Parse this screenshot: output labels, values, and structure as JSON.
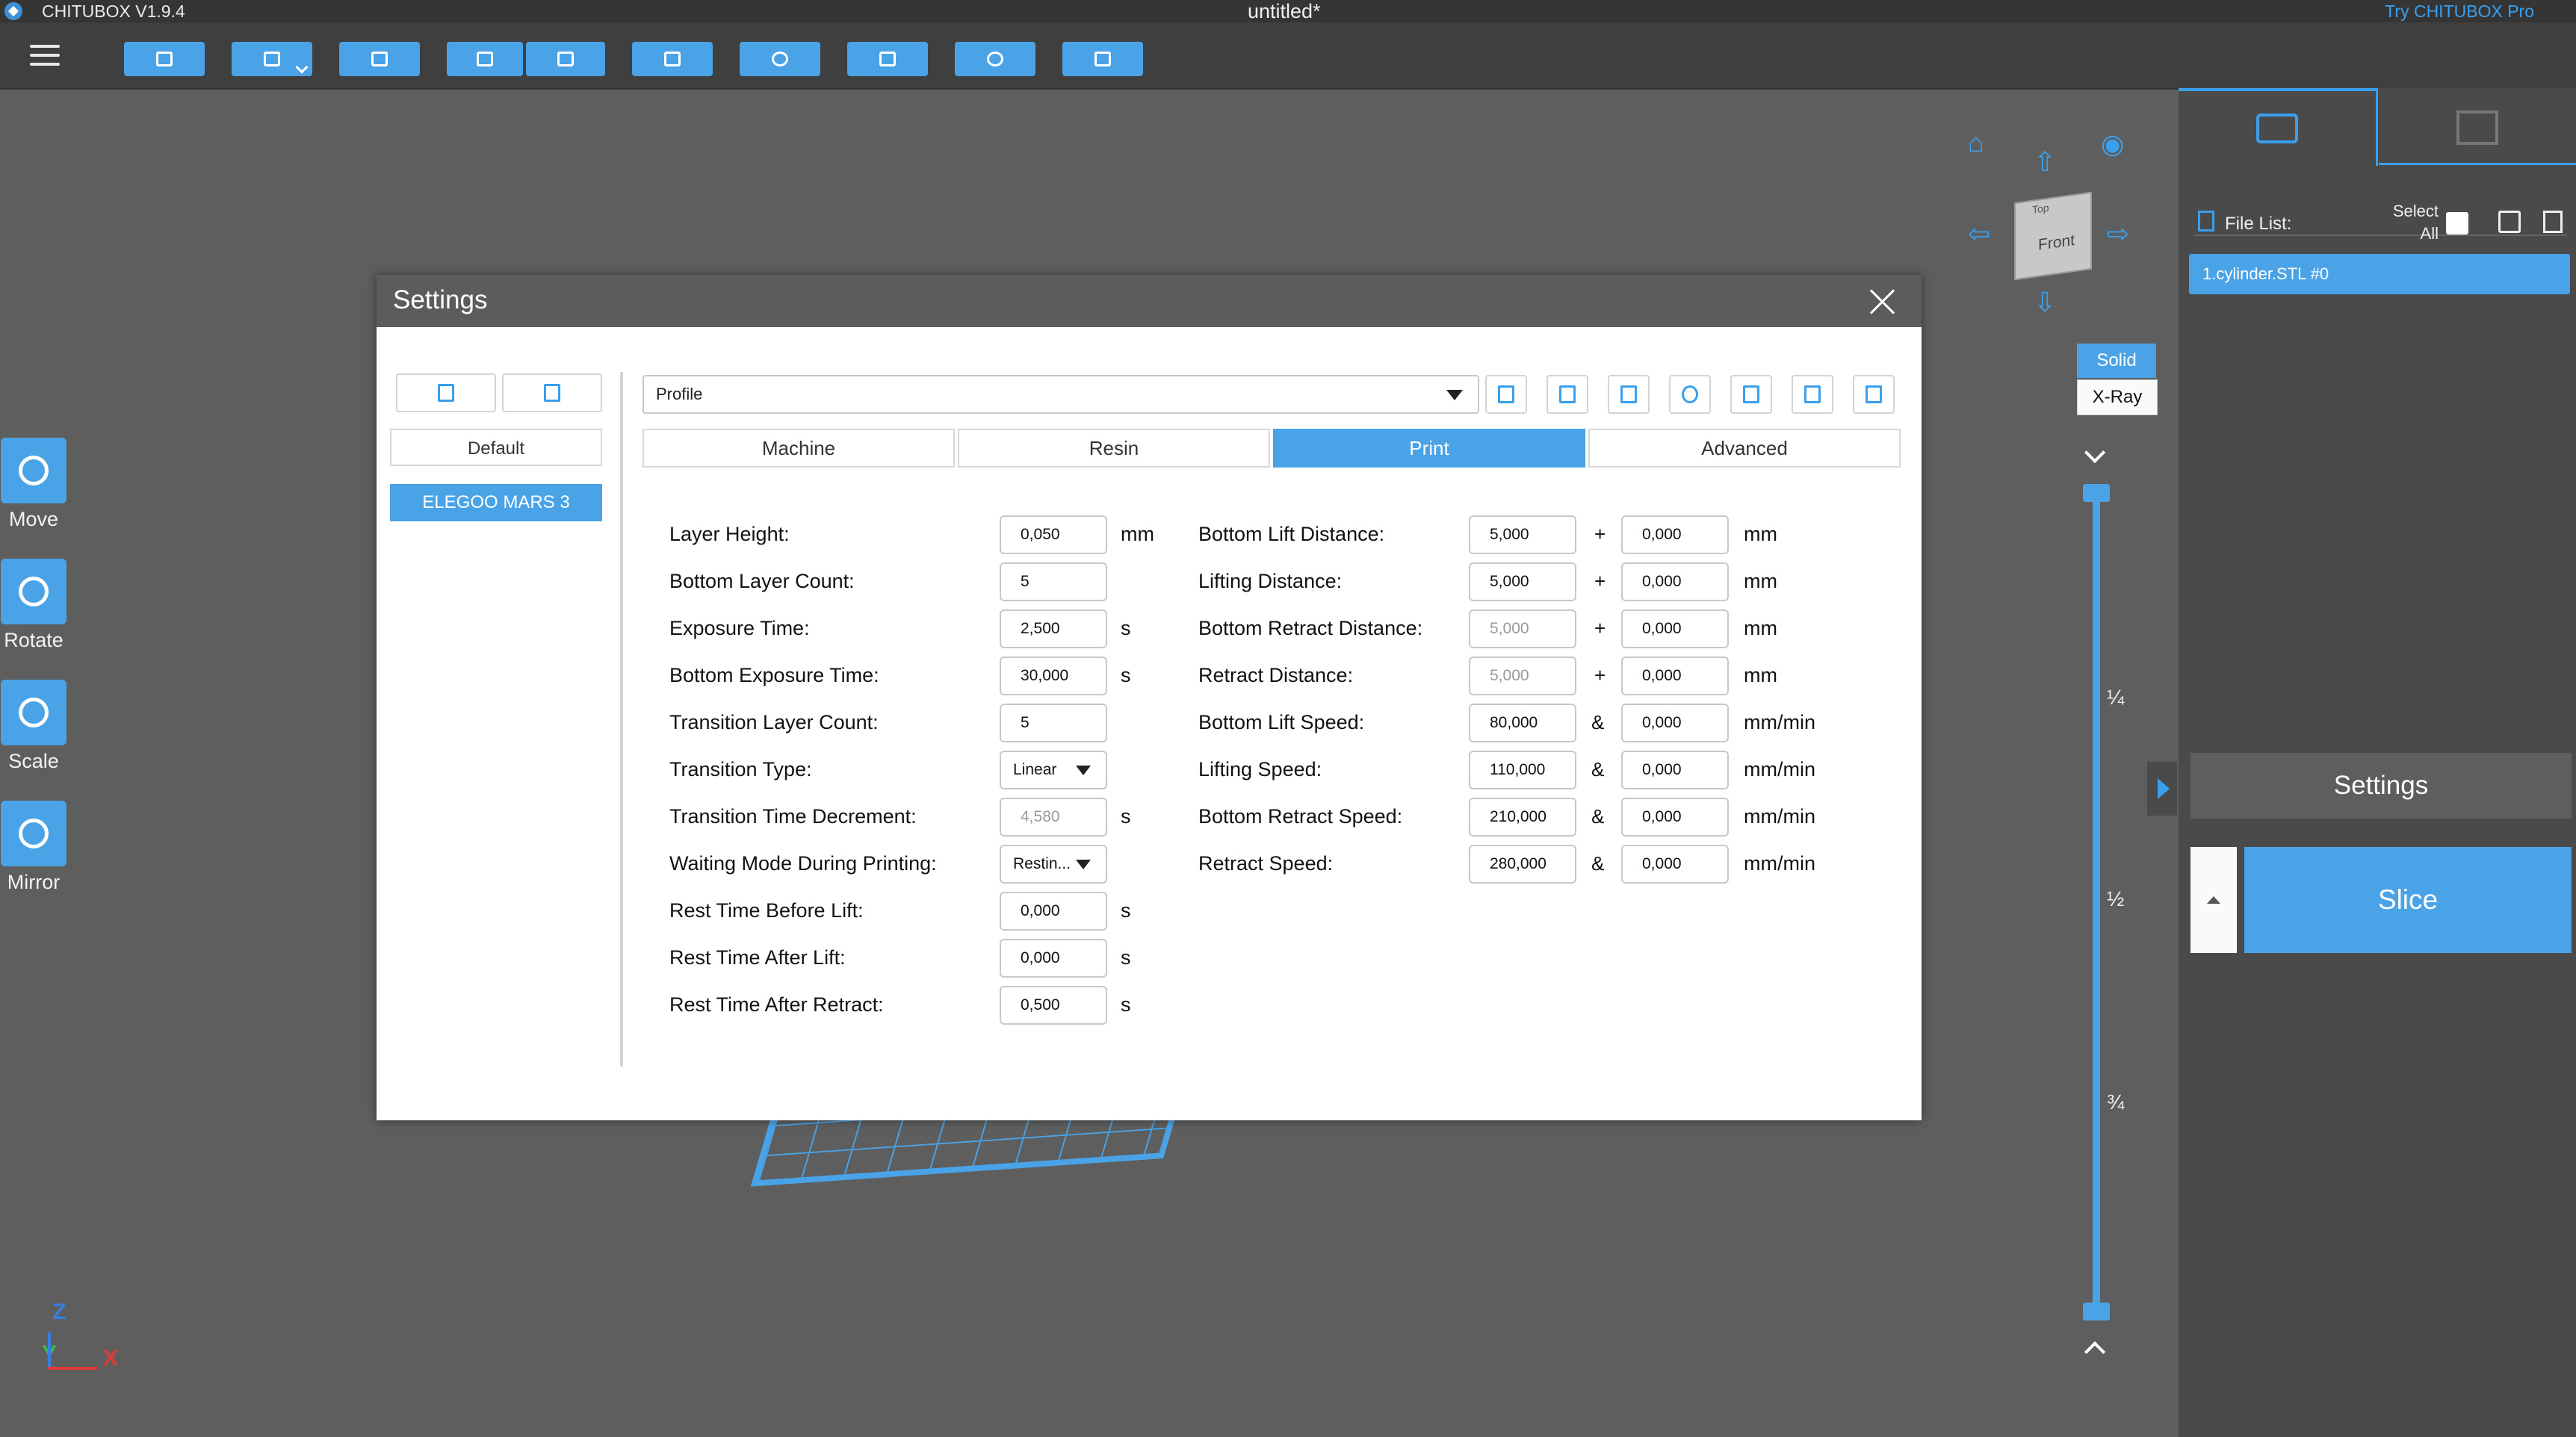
{
  "app": {
    "name": "CHITUBOX V1.9.4",
    "document_title": "untitled*",
    "try_pro": "Try CHITUBOX Pro"
  },
  "toolbar": {
    "icons": [
      "open-file-icon",
      "save-icon",
      "auto-layout-icon",
      "undo-icon",
      "redo-icon",
      "log-icon",
      "supports-icon",
      "hollow-icon",
      "drill-icon",
      "print-icon"
    ]
  },
  "tools": [
    {
      "label": "Move",
      "icon": "move-icon"
    },
    {
      "label": "Rotate",
      "icon": "rotate-icon"
    },
    {
      "label": "Scale",
      "icon": "scale-icon"
    },
    {
      "label": "Mirror",
      "icon": "mirror-icon"
    }
  ],
  "axis": {
    "z": "Z",
    "y": "Y",
    "x": "X",
    "colors": {
      "z": "#3a7fe0",
      "y": "#36c04a",
      "x": "#e03a3a"
    }
  },
  "view": {
    "cube_face": "Front",
    "cube_top": "Top",
    "solid": "Solid",
    "xray": "X-Ray"
  },
  "slider": {
    "marks": [
      "¼",
      "½",
      "¾"
    ]
  },
  "right_panel": {
    "file_list_label": "File List:",
    "select_all": "Select All",
    "files": [
      "1.cylinder.STL #0"
    ],
    "settings_button": "Settings",
    "slice_button": "Slice"
  },
  "dialog": {
    "title": "Settings",
    "profiles": [
      "Default",
      "ELEGOO MARS 3"
    ],
    "selected_profile": "ELEGOO MARS 3",
    "profile_dropdown": "Profile",
    "tabs": [
      "Machine",
      "Resin",
      "Print",
      "Advanced"
    ],
    "active_tab": "Print",
    "left_fields": [
      {
        "label": "Layer Height:",
        "value": "0,050",
        "unit": "mm"
      },
      {
        "label": "Bottom Layer Count:",
        "value": "5",
        "unit": ""
      },
      {
        "label": "Exposure Time:",
        "value": "2,500",
        "unit": "s"
      },
      {
        "label": "Bottom Exposure Time:",
        "value": "30,000",
        "unit": "s"
      },
      {
        "label": "Transition Layer Count:",
        "value": "5",
        "unit": ""
      },
      {
        "label": "Transition Type:",
        "value": "Linear",
        "unit": ""
      },
      {
        "label": "Transition Time Decrement:",
        "value": "4,580",
        "unit": "s"
      },
      {
        "label": "Waiting Mode During Printing:",
        "value": "Restin...",
        "unit": ""
      },
      {
        "label": "Rest Time Before Lift:",
        "value": "0,000",
        "unit": "s"
      },
      {
        "label": "Rest Time After Lift:",
        "value": "0,000",
        "unit": "s"
      },
      {
        "label": "Rest Time After Retract:",
        "value": "0,500",
        "unit": "s"
      }
    ],
    "right_fields": [
      {
        "label": "Bottom Lift Distance:",
        "value1": "5,000",
        "op": "+",
        "value2": "0,000",
        "unit": "mm"
      },
      {
        "label": "Lifting Distance:",
        "value1": "5,000",
        "op": "+",
        "value2": "0,000",
        "unit": "mm"
      },
      {
        "label": "Bottom Retract Distance:",
        "value1": "5,000",
        "op": "+",
        "value2": "0,000",
        "unit": "mm"
      },
      {
        "label": "Retract Distance:",
        "value1": "5,000",
        "op": "+",
        "value2": "0,000",
        "unit": "mm"
      },
      {
        "label": "Bottom Lift Speed:",
        "value1": "80,000",
        "op": "&",
        "value2": "0,000",
        "unit": "mm/min"
      },
      {
        "label": "Lifting Speed:",
        "value1": "110,000",
        "op": "&",
        "value2": "0,000",
        "unit": "mm/min"
      },
      {
        "label": "Bottom Retract Speed:",
        "value1": "210,000",
        "op": "&",
        "value2": "0,000",
        "unit": "mm/min"
      },
      {
        "label": "Retract Speed:",
        "value1": "280,000",
        "op": "&",
        "value2": "0,000",
        "unit": "mm/min"
      }
    ]
  },
  "colors": {
    "accent": "#4aa3e7",
    "background": "#5e5e5e",
    "dialog_header": "#5c5c5c"
  }
}
